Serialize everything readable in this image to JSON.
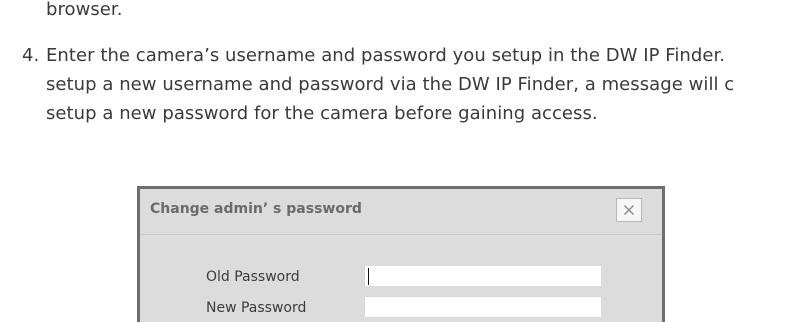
{
  "document": {
    "line_prev": "browser.",
    "step_number": "4.",
    "step_line1": "Enter the camera’s username and password you setup in the DW IP Finder.",
    "step_line2": "setup a new username and password via the DW IP Finder, a message will c",
    "step_line3": "setup a new password for the camera before gaining access."
  },
  "dialog": {
    "title": "Change admin’ s password",
    "close_glyph": "✕",
    "fields": [
      {
        "label": "Old Password",
        "value": ""
      },
      {
        "label": "New Password",
        "value": ""
      }
    ]
  },
  "colors": {
    "dialog_background": "#dcdcdc",
    "dialog_border": "#6e6e6e",
    "body_text": "#3a3a3a"
  }
}
